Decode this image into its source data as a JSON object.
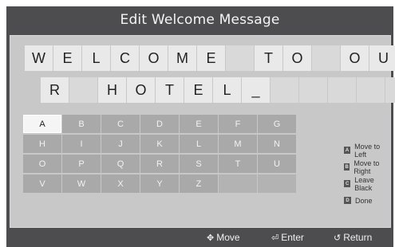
{
  "dialog": {
    "title": "Edit Welcome Message"
  },
  "message": {
    "row1": [
      "W",
      "E",
      "L",
      "C",
      "O",
      "M",
      "E",
      "",
      "T",
      "O",
      "",
      "O",
      "U"
    ],
    "row2": [
      "R",
      "",
      "H",
      "O",
      "T",
      "E",
      "L",
      "_",
      "",
      "",
      "",
      "",
      ""
    ]
  },
  "keyboard": {
    "rows": [
      [
        "A",
        "B",
        "C",
        "D",
        "E",
        "F",
        "G"
      ],
      [
        "H",
        "I",
        "J",
        "K",
        "L",
        "M",
        "N"
      ],
      [
        "O",
        "P",
        "Q",
        "R",
        "S",
        "T",
        "U"
      ],
      [
        "V",
        "W",
        "X",
        "Y",
        "Z",
        "",
        ""
      ]
    ],
    "selected": "A"
  },
  "legend": [
    {
      "badge": "A",
      "label": "Move to Left",
      "color": "#555555"
    },
    {
      "badge": "B",
      "label": "Move to Right",
      "color": "#555555"
    },
    {
      "badge": "C",
      "label": "Leave Black",
      "color": "#555555"
    },
    {
      "badge": "D",
      "label": "Done",
      "color": "#555555"
    }
  ],
  "bottom": {
    "move": {
      "icon": "move-icon",
      "label": "Move"
    },
    "enter": {
      "icon": "enter-icon",
      "label": "Enter"
    },
    "return": {
      "icon": "return-icon",
      "label": "Return"
    }
  }
}
